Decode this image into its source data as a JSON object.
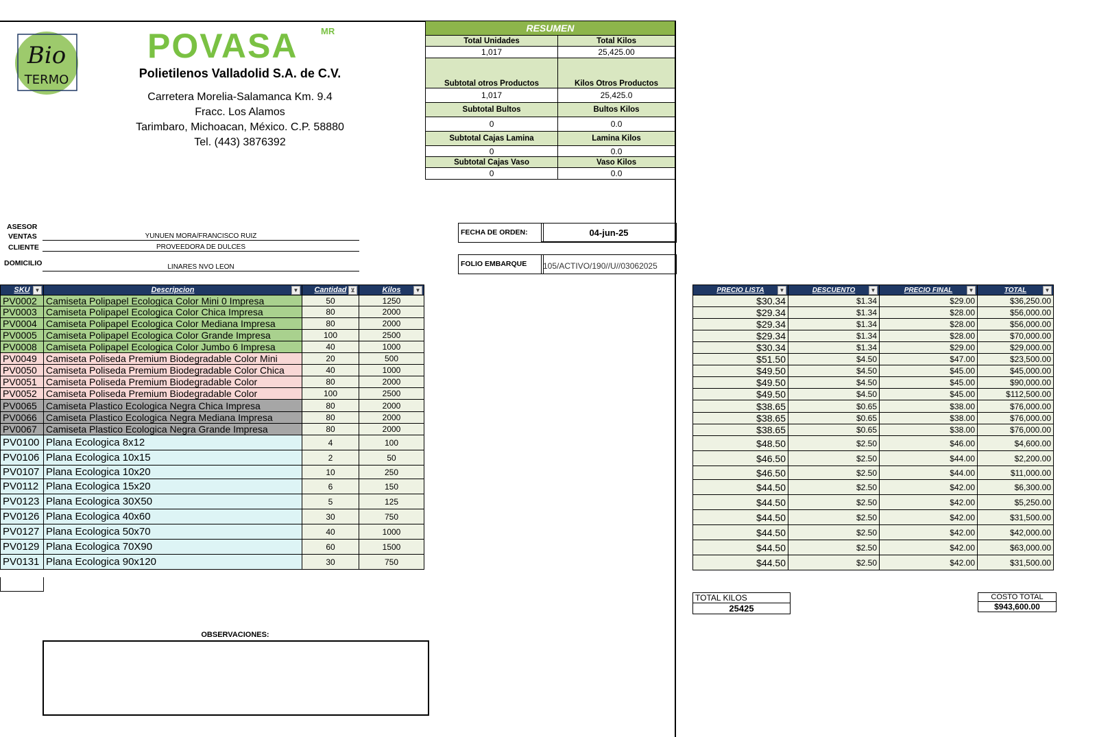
{
  "brand": {
    "name": "POVASA",
    "mark": "MR",
    "logo_text_1": "Bio",
    "logo_text_2": "TERMO"
  },
  "company": {
    "name": "Polietilenos Valladolid S.A. de C.V.",
    "address_1": "Carretera Morelia-Salamanca Km. 9.4",
    "address_2": "Fracc. Los Alamos",
    "address_3": "Tarimbaro, Michoacan, México. C.P. 58880",
    "phone": "Tel. (443) 3876392"
  },
  "resumen": {
    "title": "RESUMEN",
    "rows": [
      {
        "l1": "Total Unidades",
        "l2": "Total Kilos",
        "v1": "1,017",
        "v2": "25,425.00"
      },
      {
        "l1": "Subtotal otros Productos",
        "l2": "Kilos Otros Productos",
        "v1": "1,017",
        "v2": "25,425.0"
      },
      {
        "l1": "Subtotal Bultos",
        "l2": "Bultos Kilos",
        "v1": "0",
        "v2": "0.0"
      },
      {
        "l1": "Subtotal Cajas Lamina",
        "l2": "Lamina Kilos",
        "v1": "0",
        "v2": "0.0"
      },
      {
        "l1": "Subtotal Cajas Vaso",
        "l2": "Vaso Kilos",
        "v1": "0",
        "v2": "0.0"
      }
    ]
  },
  "meta": {
    "asesor_label": "ASESOR",
    "ventas_label": "VENTAS",
    "ventas_value": "YUNUEN MORA/FRANCISCO RUIZ",
    "cliente_label": "CLIENTE",
    "cliente_value": "PROVEEDORA DE DULCES",
    "domicilio_label": "DOMICILIO",
    "domicilio_value": "LINARES NVO LEON",
    "fecha_label": "FECHA DE ORDEN:",
    "fecha_value": "04-jun-25",
    "folio_label": "FOLIO EMBARQUE",
    "folio_value": "105/ACTIVO/190//U//03062025"
  },
  "table_headers": {
    "sku": "SKU",
    "desc": "Descripcion",
    "cantidad": "Cantidad",
    "kilos": "Kilos",
    "precio_lista": "PRECIO LISTA",
    "descuento": "DESCUENTO",
    "precio_final": "PRECIO FINAL",
    "total": "TOTAL"
  },
  "rows": [
    {
      "sku": "PV0002",
      "desc": "Camiseta Polipapel Ecologica Color Mini 0 Impresa",
      "cant": "50",
      "kilos": "1250",
      "lista": "$30.34",
      "desc_amt": "$1.34",
      "final": "$29.00",
      "total": "$36,250.00"
    },
    {
      "sku": "PV0003",
      "desc": "Camiseta Polipapel Ecologica Color Chica Impresa",
      "cant": "80",
      "kilos": "2000",
      "lista": "$29.34",
      "desc_amt": "$1.34",
      "final": "$28.00",
      "total": "$56,000.00"
    },
    {
      "sku": "PV0004",
      "desc": "Camiseta Polipapel Ecologica Color Mediana Impresa",
      "cant": "80",
      "kilos": "2000",
      "lista": "$29.34",
      "desc_amt": "$1.34",
      "final": "$28.00",
      "total": "$56,000.00"
    },
    {
      "sku": "PV0005",
      "desc": "Camiseta Polipapel Ecologica Color Grande Impresa",
      "cant": "100",
      "kilos": "2500",
      "lista": "$29.34",
      "desc_amt": "$1.34",
      "final": "$28.00",
      "total": "$70,000.00"
    },
    {
      "sku": "PV0008",
      "desc": "Camiseta Polipapel Ecologica Color Jumbo 6 Impresa",
      "cant": "40",
      "kilos": "1000",
      "lista": "$30.34",
      "desc_amt": "$1.34",
      "final": "$29.00",
      "total": "$29,000.00"
    },
    {
      "sku": "PV0049",
      "desc": "Camiseta Poliseda Premium Biodegradable Color Mini",
      "cant": "20",
      "kilos": "500",
      "lista": "$51.50",
      "desc_amt": "$4.50",
      "final": "$47.00",
      "total": "$23,500.00"
    },
    {
      "sku": "PV0050",
      "desc": "Camiseta Poliseda Premium Biodegradable Color Chica",
      "cant": "40",
      "kilos": "1000",
      "lista": "$49.50",
      "desc_amt": "$4.50",
      "final": "$45.00",
      "total": "$45,000.00"
    },
    {
      "sku": "PV0051",
      "desc": "Camiseta Poliseda Premium Biodegradable Color",
      "cant": "80",
      "kilos": "2000",
      "lista": "$49.50",
      "desc_amt": "$4.50",
      "final": "$45.00",
      "total": "$90,000.00"
    },
    {
      "sku": "PV0052",
      "desc": "Camiseta Poliseda Premium Biodegradable Color",
      "cant": "100",
      "kilos": "2500",
      "lista": "$49.50",
      "desc_amt": "$4.50",
      "final": "$45.00",
      "total": "$112,500.00"
    },
    {
      "sku": "PV0065",
      "desc": "Camiseta Plastico Ecologica Negra Chica Impresa",
      "cant": "80",
      "kilos": "2000",
      "lista": "$38.65",
      "desc_amt": "$0.65",
      "final": "$38.00",
      "total": "$76,000.00"
    },
    {
      "sku": "PV0066",
      "desc": "Camiseta Plastico Ecologica Negra Mediana Impresa",
      "cant": "80",
      "kilos": "2000",
      "lista": "$38.65",
      "desc_amt": "$0.65",
      "final": "$38.00",
      "total": "$76,000.00"
    },
    {
      "sku": "PV0067",
      "desc": "Camiseta Plastico Ecologica Negra Grande Impresa",
      "cant": "80",
      "kilos": "2000",
      "lista": "$38.65",
      "desc_amt": "$0.65",
      "final": "$38.00",
      "total": "$76,000.00"
    },
    {
      "sku": "PV0100",
      "desc": "Plana Ecologica 8x12",
      "cant": "4",
      "kilos": "100",
      "lista": "$48.50",
      "desc_amt": "$2.50",
      "final": "$46.00",
      "total": "$4,600.00"
    },
    {
      "sku": "PV0106",
      "desc": "Plana Ecologica 10x15",
      "cant": "2",
      "kilos": "50",
      "lista": "$46.50",
      "desc_amt": "$2.50",
      "final": "$44.00",
      "total": "$2,200.00"
    },
    {
      "sku": "PV0107",
      "desc": "Plana Ecologica 10x20",
      "cant": "10",
      "kilos": "250",
      "lista": "$46.50",
      "desc_amt": "$2.50",
      "final": "$44.00",
      "total": "$11,000.00"
    },
    {
      "sku": "PV0112",
      "desc": "Plana Ecologica 15x20",
      "cant": "6",
      "kilos": "150",
      "lista": "$44.50",
      "desc_amt": "$2.50",
      "final": "$42.00",
      "total": "$6,300.00"
    },
    {
      "sku": "PV0123",
      "desc": "Plana Ecologica 30X50",
      "cant": "5",
      "kilos": "125",
      "lista": "$44.50",
      "desc_amt": "$2.50",
      "final": "$42.00",
      "total": "$5,250.00"
    },
    {
      "sku": "PV0126",
      "desc": "Plana Ecologica 40x60",
      "cant": "30",
      "kilos": "750",
      "lista": "$44.50",
      "desc_amt": "$2.50",
      "final": "$42.00",
      "total": "$31,500.00"
    },
    {
      "sku": "PV0127",
      "desc": "Plana Ecologica 50x70",
      "cant": "40",
      "kilos": "1000",
      "lista": "$44.50",
      "desc_amt": "$2.50",
      "final": "$42.00",
      "total": "$42,000.00"
    },
    {
      "sku": "PV0129",
      "desc": "Plana Ecologica 70X90",
      "cant": "60",
      "kilos": "1500",
      "lista": "$44.50",
      "desc_amt": "$2.50",
      "final": "$42.00",
      "total": "$63,000.00"
    },
    {
      "sku": "PV0131",
      "desc": "Plana Ecologica 90x120",
      "cant": "30",
      "kilos": "750",
      "lista": "$44.50",
      "desc_amt": "$2.50",
      "final": "$42.00",
      "total": "$31,500.00"
    }
  ],
  "totals": {
    "kilos_label": "TOTAL KILOS",
    "kilos_value": "25425",
    "costo_label": "COSTO TOTAL",
    "costo_value": "$943,600.00"
  },
  "observaciones_label": "OBSERVACIONES:"
}
